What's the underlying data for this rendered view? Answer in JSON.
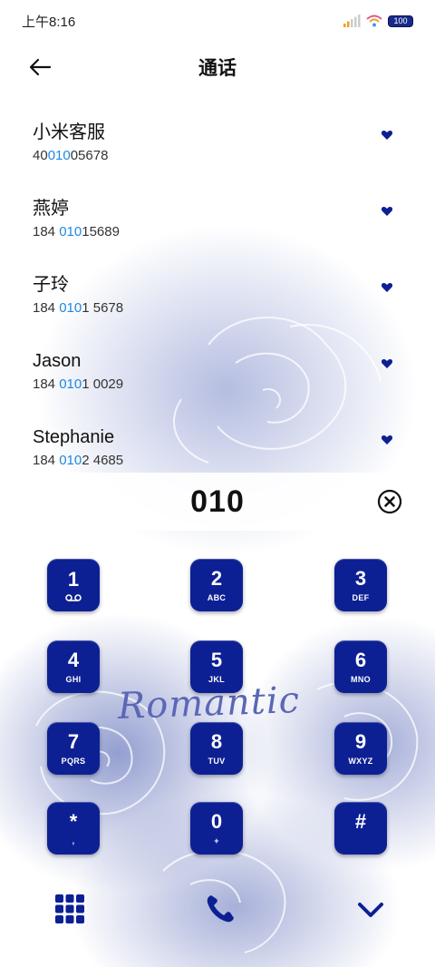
{
  "status_bar": {
    "time": "上午8:16",
    "battery": "100"
  },
  "header": {
    "title": "通话"
  },
  "contacts": [
    {
      "name": "小米客服",
      "number_pre": "40",
      "number_match": "010",
      "number_post": "05678"
    },
    {
      "name": "燕婷",
      "number_pre": "184 ",
      "number_match": "010",
      "number_post": "15689"
    },
    {
      "name": "子玲",
      "number_pre": "184 ",
      "number_match": "010",
      "number_post": "1 5678"
    },
    {
      "name": "Jason",
      "number_pre": "184 ",
      "number_match": "010",
      "number_post": "1 0029"
    },
    {
      "name": "Stephanie",
      "number_pre": "184 ",
      "number_match": "010",
      "number_post": "2 4685"
    }
  ],
  "dialer": {
    "input": "010"
  },
  "keypad": [
    {
      "digit": "1",
      "letters": "voicemail-icon"
    },
    {
      "digit": "2",
      "letters": "ABC"
    },
    {
      "digit": "3",
      "letters": "DEF"
    },
    {
      "digit": "4",
      "letters": "GHI"
    },
    {
      "digit": "5",
      "letters": "JKL"
    },
    {
      "digit": "6",
      "letters": "MNO"
    },
    {
      "digit": "7",
      "letters": "PQRS"
    },
    {
      "digit": "8",
      "letters": "TUV"
    },
    {
      "digit": "9",
      "letters": "WXYZ"
    },
    {
      "digit": "*",
      "letters": ","
    },
    {
      "digit": "0",
      "letters": "+"
    },
    {
      "digit": "#",
      "letters": ""
    }
  ],
  "theme": {
    "watermark": "Romantic",
    "accent": "#0d2093",
    "match_color": "#1e88e5"
  }
}
